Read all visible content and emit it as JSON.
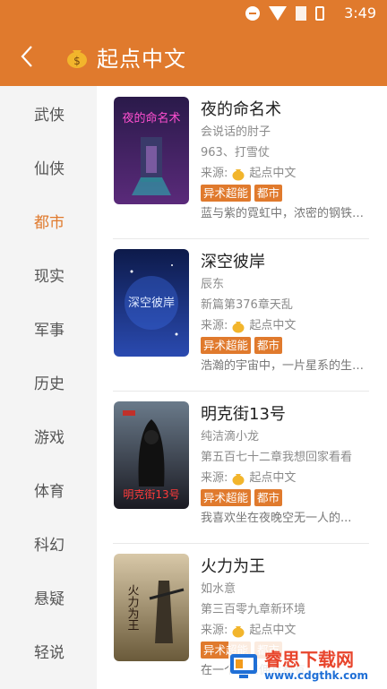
{
  "status_bar": {
    "time": "3:49"
  },
  "header": {
    "title": "起点中文",
    "back_icon": "chevron-left-icon",
    "logo_icon": "money-bag-icon"
  },
  "sidebar": {
    "items": [
      {
        "label": "武侠",
        "active": false
      },
      {
        "label": "仙侠",
        "active": false
      },
      {
        "label": "都市",
        "active": true
      },
      {
        "label": "现实",
        "active": false
      },
      {
        "label": "军事",
        "active": false
      },
      {
        "label": "历史",
        "active": false
      },
      {
        "label": "游戏",
        "active": false
      },
      {
        "label": "体育",
        "active": false
      },
      {
        "label": "科幻",
        "active": false
      },
      {
        "label": "悬疑",
        "active": false
      },
      {
        "label": "轻说",
        "active": false
      }
    ]
  },
  "books": [
    {
      "title": "夜的命名术",
      "author": "会说话的肘子",
      "chapter": "963、打雪仗",
      "source_label": "来源:",
      "source_name": "起点中文",
      "tags": [
        "异术超能",
        "都市"
      ],
      "desc": "蓝与紫的霓虹中，浓密的钢铁苍穹下",
      "cover_text": "夜的命名术"
    },
    {
      "title": "深空彼岸",
      "author": "辰东",
      "chapter": "新篇第376章天乱",
      "source_label": "来源:",
      "source_name": "起点中文",
      "tags": [
        "异术超能",
        "都市"
      ],
      "desc": "浩瀚的宇宙中，一片星系的生灭，也不",
      "cover_text": "深空彼岸"
    },
    {
      "title": "明克街13号",
      "author": "纯洁滴小龙",
      "chapter": "第五百七十二章我想回家看看",
      "source_label": "来源:",
      "source_name": "起点中文",
      "tags": [
        "异术超能",
        "都市"
      ],
      "desc": "我喜欢坐在夜晚空无一人的...",
      "cover_text": "明克街13号"
    },
    {
      "title": "火力为王",
      "author": "如水意",
      "chapter": "第三百零九章新环境",
      "source_label": "来源:",
      "source_name": "起点中文",
      "tags": [
        "异术超能",
        "都市"
      ],
      "desc": "在一个当雇佣兵都有...",
      "cover_text": "火力为王"
    }
  ],
  "watermark": {
    "main": "睿思下载网",
    "sub": "www.cdgthk.com"
  }
}
